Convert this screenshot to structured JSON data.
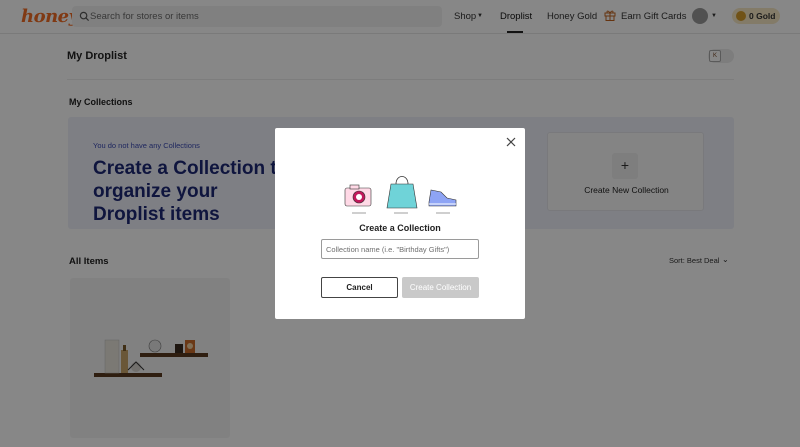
{
  "header": {
    "logo": "honey",
    "search_placeholder": "Search for stores or items",
    "nav": {
      "shop": "Shop",
      "droplist": "Droplist",
      "honey_gold": "Honey Gold",
      "earn_gift_cards": "Earn Gift Cards"
    },
    "gold_balance": "0 Gold"
  },
  "page": {
    "title": "My Droplist",
    "toggle_label": "K"
  },
  "collections": {
    "title": "My Collections",
    "banner_note": "You do not have any Collections",
    "banner_heading": "Create a Collection to organize your Droplist items",
    "new_collection_plus": "+",
    "new_collection_label": "Create New Collection"
  },
  "items": {
    "title": "All Items",
    "sort_label": "Sort: Best Deal"
  },
  "modal": {
    "title": "Create a Collection",
    "input_placeholder": "Collection name (i.e. \"Birthday Gifts\")",
    "cancel_label": "Cancel",
    "create_label": "Create Collection"
  },
  "colors": {
    "brand": "#f26c25",
    "banner_bg": "#eef0f9",
    "banner_text": "#1d2875",
    "disabled_button": "#c9c9c9"
  },
  "icons": {
    "search": "search-icon",
    "gift": "gift-icon",
    "close": "close-icon",
    "plus": "plus-icon",
    "sort_caret": "chevron-down-icon"
  }
}
